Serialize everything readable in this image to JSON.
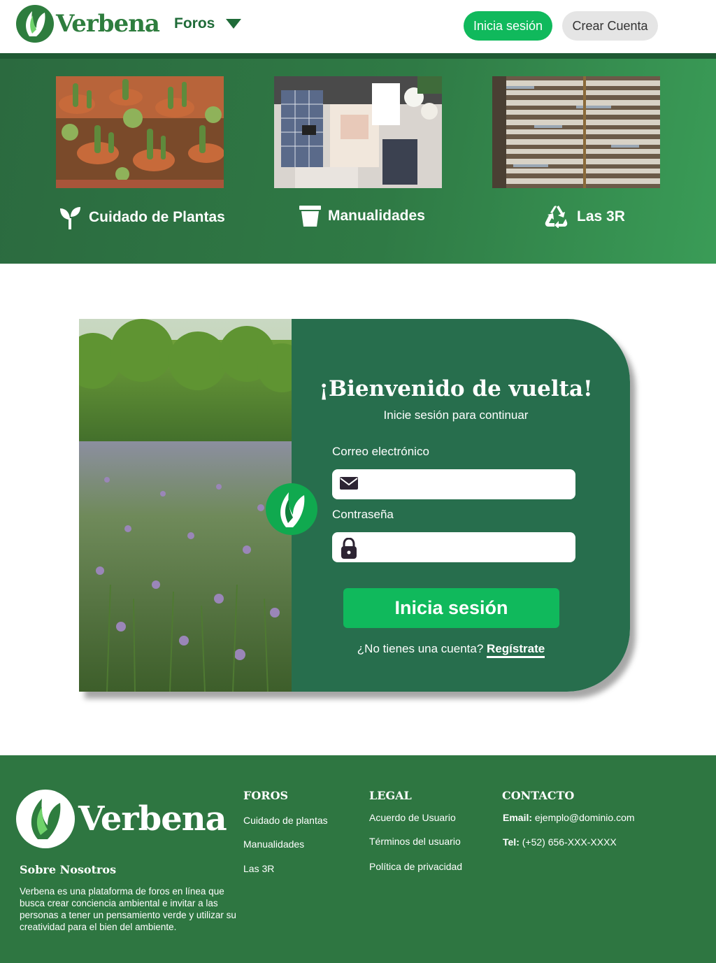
{
  "header": {
    "logo_text": "Verbena",
    "menu_label": "Foros",
    "login_label": "Inicia sesión",
    "signup_label": "Crear Cuenta"
  },
  "categories": [
    {
      "label": "Cuidado de Plantas",
      "icon": "sprout-icon"
    },
    {
      "label": "Manualidades",
      "icon": "cup-icon"
    },
    {
      "label": "Las 3R",
      "icon": "recycle-icon"
    }
  ],
  "login": {
    "title": "¡Bienvenido de vuelta!",
    "subtitle": "Inicie sesión para continuar",
    "email_label": "Correo electrónico",
    "email_value": "",
    "password_label": "Contraseña",
    "password_value": "",
    "submit_label": "Inicia sesión",
    "no_account_text": "¿No tienes una cuenta?",
    "register_link": "Regístrate"
  },
  "footer": {
    "logo_text": "Verbena",
    "about_title": "Sobre Nosotros",
    "about_text": "Verbena es una plataforma de foros en línea que busca crear conciencia ambiental e invitar a las personas a tener un pensamiento verde y utilizar su creatividad para el bien del ambiente.",
    "foros": {
      "title": "FOROS",
      "items": [
        "Cuidado de plantas",
        "Manualidades",
        "Las 3R"
      ]
    },
    "legal": {
      "title": "LEGAL",
      "items": [
        "Acuerdo de Usuario",
        "Términos del usuario",
        "Política de privacidad"
      ]
    },
    "contacto": {
      "title": "CONTACTO",
      "email_label": "Email:",
      "email_value": "ejemplo@dominio.com",
      "tel_label": "Tel:",
      "tel_value": "(+52) 656-XXX-XXXX"
    }
  },
  "colors": {
    "brand_green": "#2e7d3e",
    "accent_green": "#10b95c",
    "panel_green": "#276e4d",
    "footer_green": "#2e7641"
  }
}
